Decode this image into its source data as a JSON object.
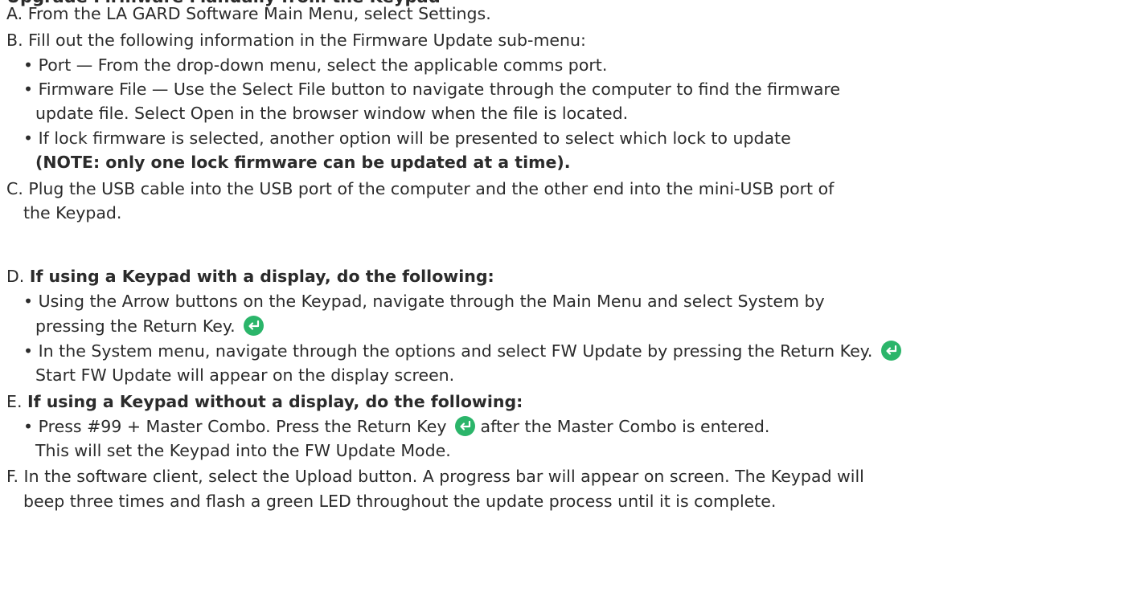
{
  "heading_fragment": "Upgrade Firmware Manually from the Keypad",
  "colors": {
    "text": "#2b2b2b",
    "return_key": "#2bb56a"
  },
  "icons": {
    "return_key": "return-key-icon"
  },
  "steps": {
    "A": {
      "marker": "A.",
      "text": "From the LA GARD Software Main Menu, select Settings."
    },
    "B": {
      "marker": "B.",
      "text": "Fill out the following information in the Firmware Update sub-menu:",
      "bullets": {
        "b1": "• Port — From the drop-down menu, select the applicable comms port.",
        "b2_l1": "• Firmware File — Use the Select File button to navigate through the computer to find the firmware",
        "b2_l2": "update file. Select Open in the browser window when the file is located.",
        "b3_l1": "• If lock firmware is selected, another option will be presented to select which lock to update",
        "b3_l2": "(NOTE: only one lock firmware can be updated at a time)."
      }
    },
    "C": {
      "marker": "C.",
      "l1": "Plug the USB cable into the USB port of the computer and the other end into the mini-USB port of",
      "l2": "the Keypad."
    },
    "D": {
      "marker": "D.",
      "text": "If using a Keypad with a display, do the following:",
      "bullets": {
        "b1_l1": "• Using the Arrow buttons on the Keypad, navigate through the Main Menu and select System by",
        "b1_l2": "pressing the Return Key.",
        "b2_l1": "• In the System menu, navigate through the options and select FW Update by pressing the Return Key.",
        "b2_l2": "Start FW Update will appear on the display screen."
      }
    },
    "E": {
      "marker": "E.",
      "text": "If using a Keypad without a display, do the following:",
      "bullets": {
        "b1_l1a": "• Press #99 + Master Combo. Press the Return Key",
        "b1_l1b": "after the Master Combo is entered.",
        "b1_l2": "This will set the Keypad into the FW Update Mode."
      }
    },
    "F": {
      "marker": "F.",
      "l1": "In the software client, select the Upload button. A progress bar will appear on screen. The Keypad will",
      "l2": "beep three times and flash a green LED throughout the update process until it is complete."
    }
  }
}
